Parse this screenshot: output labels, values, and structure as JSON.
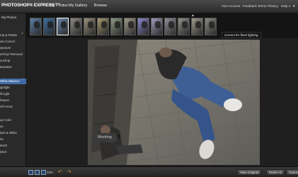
{
  "app": {
    "logo_text": "PHOTOSHOP® EXPRESS",
    "beta_label": "BETA"
  },
  "nav": {
    "my_photos": "My Photos",
    "my_gallery": "My Gallery",
    "browse": "Browse"
  },
  "header_links": {
    "account": "Your Account",
    "feedback": "Feedback",
    "terms": "Terms",
    "privacy": "Privacy",
    "help": "Help"
  },
  "sidebar": {
    "my_photos_link": "My Photos",
    "tools": [
      {
        "label": "rop & Rotate",
        "checked": true
      },
      {
        "label": "uto Correct",
        "checked": false
      },
      {
        "label": "xposure",
        "checked": false
      },
      {
        "label": "ed-Eye Removal",
        "checked": false
      },
      {
        "label": "ouchup",
        "checked": false
      },
      {
        "label": "aturation",
        "checked": false
      },
      {
        "label": "White Balance",
        "checked": true,
        "active": true
      },
      {
        "label": "ighlight",
        "checked": false
      },
      {
        "label": "ill Light",
        "checked": false
      },
      {
        "label": "harpen",
        "checked": false
      },
      {
        "label": "oft Focus",
        "checked": false
      },
      {
        "label": "op Color",
        "checked": false
      },
      {
        "label": "ue",
        "checked": false
      },
      {
        "label": "lack & White",
        "checked": false
      },
      {
        "label": "int",
        "checked": false
      },
      {
        "label": "ketch",
        "checked": false
      },
      {
        "label": "istort",
        "checked": false
      }
    ]
  },
  "filmstrip": {
    "tooltip": "Correct for flash lighting",
    "selected_index": 2,
    "thumbnails": [
      {
        "tint": "#5b7fa3"
      },
      {
        "tint": "#3d6f9e"
      },
      {
        "tint": "#6a86a8"
      },
      {
        "tint": "#8d8a82"
      },
      {
        "tint": "#9a8f78"
      },
      {
        "tint": "#a29870"
      },
      {
        "tint": "#8d9a86"
      },
      {
        "tint": "#a09a88"
      },
      {
        "tint": "#8a86c9"
      },
      {
        "tint": "#9e9ab9"
      },
      {
        "tint": "#8f8d96"
      },
      {
        "tint": "#908e8a"
      },
      {
        "tint": "#a09a8e"
      },
      {
        "tint": "#8c8a84"
      }
    ]
  },
  "canvas": {
    "status": "Working"
  },
  "bottombar": {
    "zoom": "33%",
    "view_original": "View Original",
    "reset_all": "Reset All",
    "cancel": "Cancel"
  },
  "colors": {
    "active_tool": "#3f6aa7",
    "undo_arrow": "#d8a73a"
  }
}
